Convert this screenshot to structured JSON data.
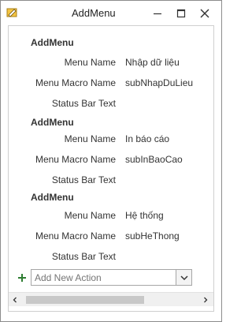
{
  "window": {
    "title": "AddMenu",
    "colors": {
      "border": "#8c8c8c",
      "plus": "#2e7d32"
    }
  },
  "blocks": [
    {
      "title": "AddMenu",
      "menu_name_label": "Menu Name",
      "menu_name_value": "Nhập dữ liệu",
      "macro_label": "Menu Macro Name",
      "macro_value": "subNhapDuLieu",
      "status_label": "Status Bar Text",
      "status_value": ""
    },
    {
      "title": "AddMenu",
      "menu_name_label": "Menu Name",
      "menu_name_value": "In báo cáo",
      "macro_label": "Menu Macro Name",
      "macro_value": "subInBaoCao",
      "status_label": "Status Bar Text",
      "status_value": ""
    },
    {
      "title": "AddMenu",
      "menu_name_label": "Menu Name",
      "menu_name_value": "Hệ thống",
      "macro_label": "Menu Macro Name",
      "macro_value": "subHeThong",
      "status_label": "Status Bar Text",
      "status_value": ""
    }
  ],
  "add_action": {
    "placeholder": "Add New Action"
  }
}
